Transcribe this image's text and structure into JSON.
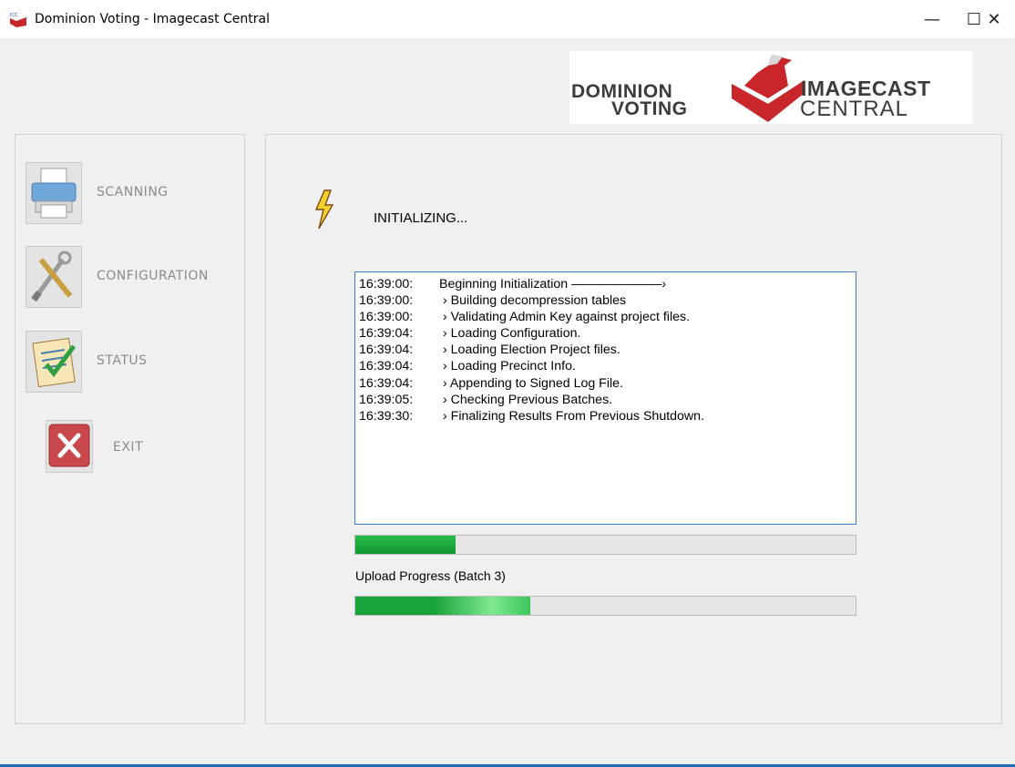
{
  "window": {
    "title": "Dominion Voting - Imagecast Central",
    "minimize_glyph": "—",
    "maximize_glyph": "☐",
    "close_glyph": "✕"
  },
  "logo": {
    "line1_left": "DOMINION",
    "line2_left": "VOTING",
    "line1_right": "IMAGECAST",
    "line2_right": "CENTRAL"
  },
  "sidebar": {
    "items": [
      {
        "label": "SCANNING",
        "icon": "printer-icon"
      },
      {
        "label": "CONFIGURATION",
        "icon": "tools-icon"
      },
      {
        "label": "STATUS",
        "icon": "checklist-icon"
      },
      {
        "label": "EXIT",
        "icon": "exit-icon"
      }
    ]
  },
  "main": {
    "status_title": "INITIALIZING...",
    "log": [
      {
        "time": "16:39:00:",
        "msg": "Beginning Initialization ———————›"
      },
      {
        "time": "16:39:00:",
        "msg": "› Building decompression tables"
      },
      {
        "time": "16:39:00:",
        "msg": "› Validating Admin Key against project files."
      },
      {
        "time": "16:39:04:",
        "msg": "› Loading Configuration."
      },
      {
        "time": "16:39:04:",
        "msg": "› Loading Election Project files."
      },
      {
        "time": "16:39:04:",
        "msg": "› Loading Precinct Info."
      },
      {
        "time": "16:39:04:",
        "msg": "› Appending to Signed Log File."
      },
      {
        "time": "16:39:05:",
        "msg": "› Checking Previous Batches."
      },
      {
        "time": "16:39:30:",
        "msg": "› Finalizing Results From Previous Shutdown."
      }
    ],
    "init_progress": 0.2,
    "upload_label": "Upload Progress (Batch 3)",
    "upload_progress": 0.35
  },
  "colors": {
    "accent_blue": "#3c7fd1",
    "progress_green": "#1aa33a",
    "brand_red": "#c8262b"
  }
}
